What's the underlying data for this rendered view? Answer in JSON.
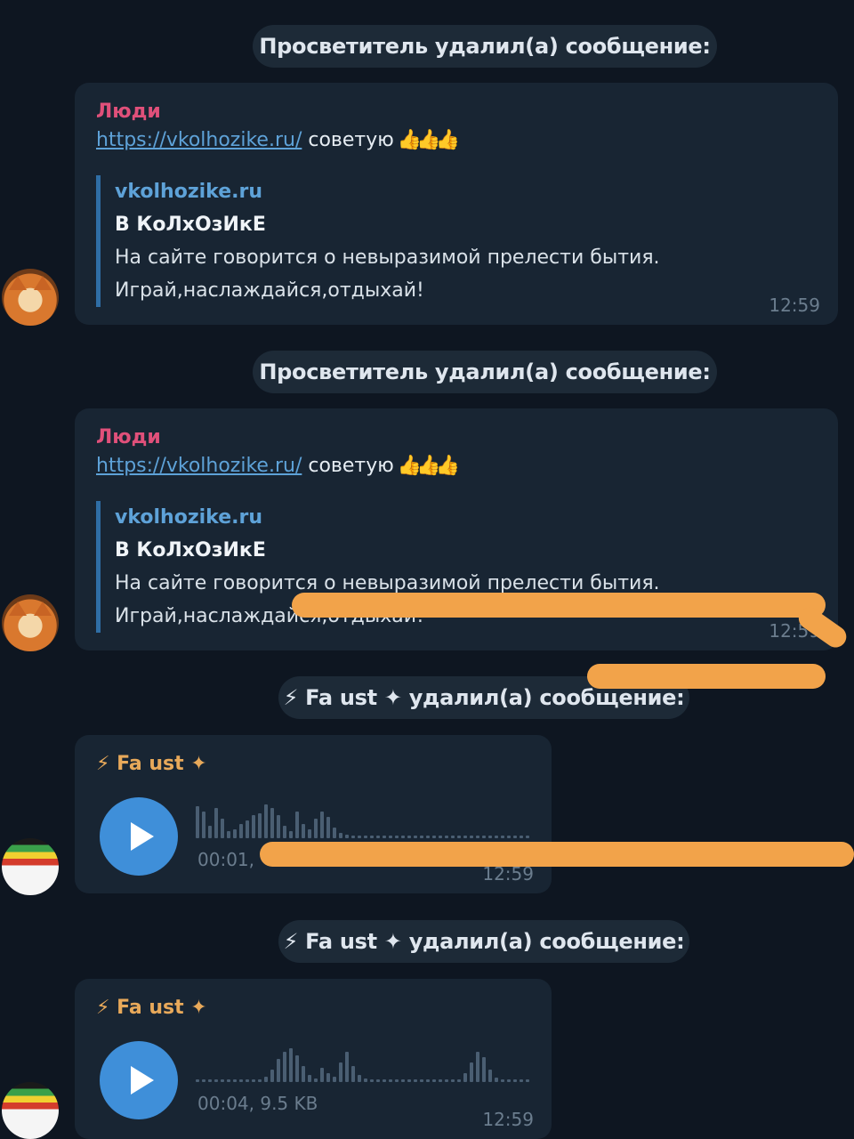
{
  "colors": {
    "background": "#0e1621",
    "bubble": "#182533",
    "link": "#5ea2d8",
    "sender_pink": "#e0507a",
    "sender_orange": "#e8a95a",
    "play_button": "#3f8fd9",
    "scribble": "#f2a34a"
  },
  "messages": [
    {
      "service": "Просветитель удалил(а) сообщение:",
      "sender": "Люди",
      "link": "https://vkolhozike.ru/",
      "text": "советую",
      "emoji": "👍👍👍",
      "preview_site": "vkolhozike.ru",
      "preview_title": "В КоЛхОзИкЕ",
      "preview_line1": "На сайте говорится о невыразимой прелести бытия.",
      "preview_line2": "Играй,наслаждайся,отдыхай!",
      "time": "12:59"
    },
    {
      "service": "Просветитель удалил(а) сообщение:",
      "sender": "Люди",
      "link": "https://vkolhozike.ru/",
      "text": "советую",
      "emoji": "👍👍👍",
      "preview_site": "vkolhozike.ru",
      "preview_title": "В КоЛхОзИкЕ",
      "preview_line1": "На сайте говорится о невыразимой прелести бытия.",
      "preview_line2": "Играй,наслаждайся,отдыхай!",
      "time": "12:59"
    }
  ],
  "voice_messages": [
    {
      "service": "⚡ Fa ust ✦ удалил(а) сообщение:",
      "sender": "⚡ Fa ust ✦",
      "info": "00:01,",
      "time": "12:59",
      "icon": "play-icon"
    },
    {
      "service": "⚡ Fa ust ✦ удалил(а) сообщение:",
      "sender": "⚡ Fa ust ✦",
      "info": "00:04, 9.5 KB",
      "time": "12:59",
      "icon": "play-icon"
    }
  ]
}
